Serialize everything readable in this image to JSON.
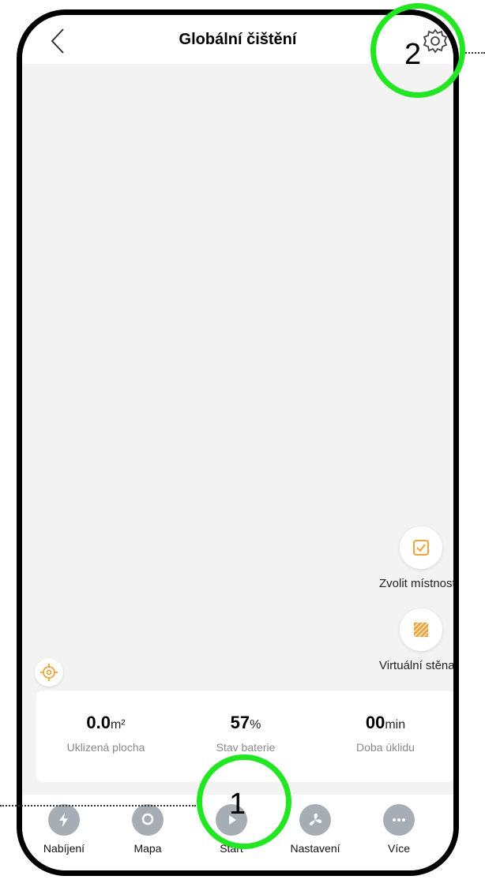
{
  "header": {
    "title": "Globální čištění"
  },
  "side_actions": [
    {
      "label": "Zvolit místnost",
      "icon": "room-select-icon"
    },
    {
      "label": "Virtuální stěna",
      "icon": "virtual-wall-icon"
    }
  ],
  "stats": [
    {
      "value": "0.0",
      "unit": "m²",
      "label": "Uklizená plocha"
    },
    {
      "value": "57",
      "unit": "%",
      "label": "Stav baterie"
    },
    {
      "value": "00",
      "unit": "min",
      "label": "Doba úklidu"
    }
  ],
  "nav": [
    {
      "label": "Nabíjení",
      "icon": "charge-icon"
    },
    {
      "label": "Mapa",
      "icon": "map-pin-icon"
    },
    {
      "label": "Start",
      "icon": "play-icon"
    },
    {
      "label": "Nastavení",
      "icon": "fan-icon"
    },
    {
      "label": "Více",
      "icon": "more-icon"
    }
  ],
  "annotations": {
    "one": "1",
    "two": "2"
  },
  "colors": {
    "accent_orange": "#f2a23a",
    "annotation_green": "#22e622",
    "nav_icon_gray": "#a7adb5"
  }
}
